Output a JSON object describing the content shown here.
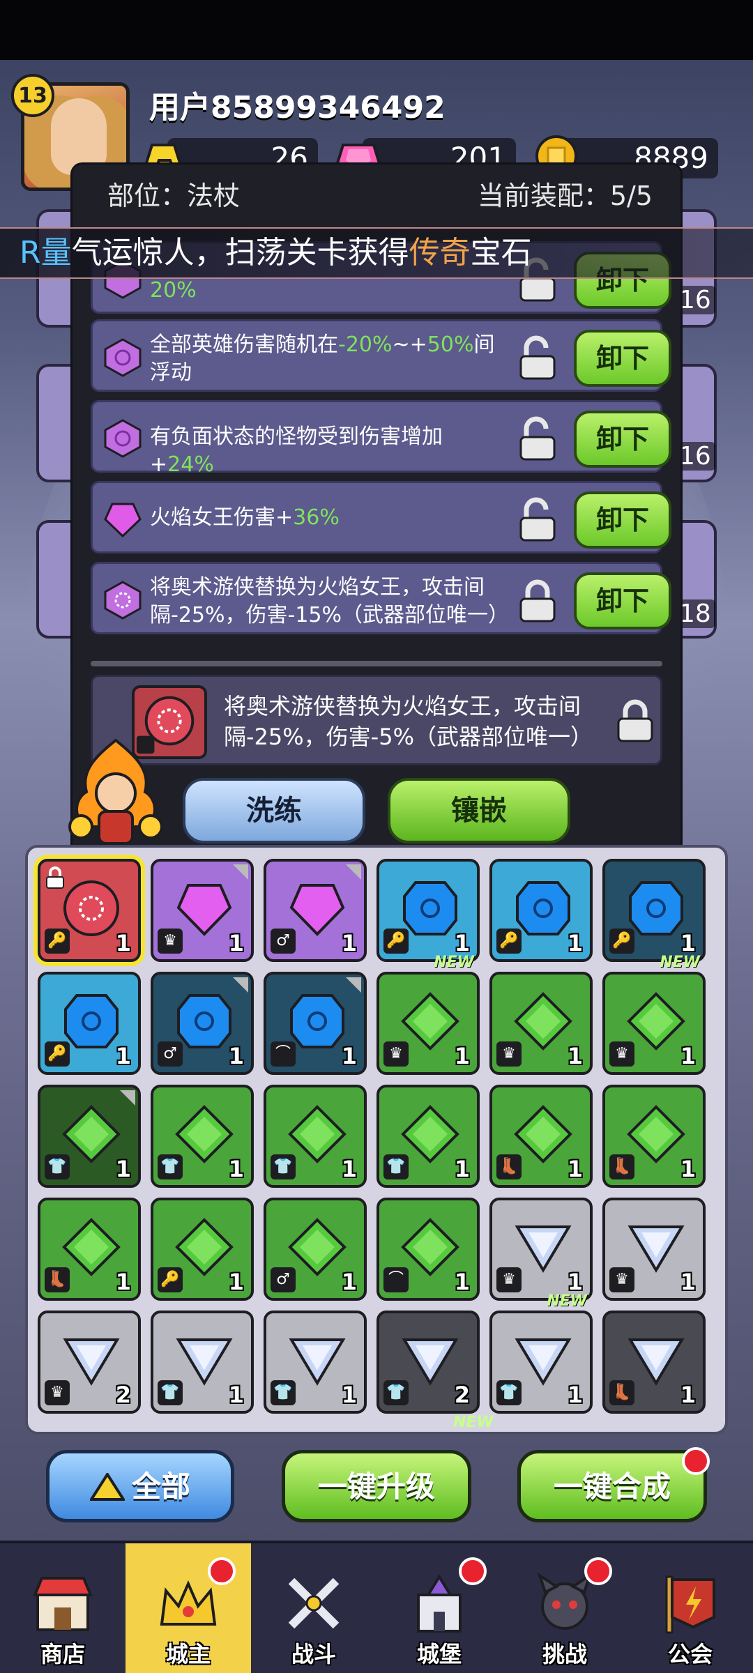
{
  "header": {
    "level": "13",
    "username": "用户85899346492",
    "resources": [
      {
        "name": "gold-bar",
        "value": "26",
        "color": "#f7d42a"
      },
      {
        "name": "pink-gem",
        "value": "201",
        "color": "#ff5fb8"
      },
      {
        "name": "gold-coin",
        "value": "8889",
        "color": "#f2b617"
      }
    ]
  },
  "marquee": {
    "prefix": "R量",
    "text1": "气运惊人，扫荡关卡获得",
    "highlight": "传奇",
    "text2": "宝石"
  },
  "popup": {
    "slot_label": "部位：法杖",
    "equipped_label": "当前装配：5/5",
    "gems": [
      {
        "pre": "",
        "mid": "20%",
        "post": "",
        "locked": false,
        "unload": "卸下",
        "color": "#c06ee0"
      },
      {
        "pre": "全部英雄伤害随机在",
        "v1": "-20%",
        "mid": "~+",
        "v2": "50%",
        "post": "间浮动",
        "locked": false,
        "unload": "卸下",
        "color": "#c06ee0"
      },
      {
        "pre": "有负面状态的怪物受到伤害增加+",
        "v1": "24%",
        "locked": false,
        "unload": "卸下",
        "color": "#c06ee0"
      },
      {
        "pre": "火焰女王伤害+",
        "v1": "36%",
        "locked": false,
        "unload": "卸下",
        "color": "#e05be8"
      },
      {
        "pre": "将奥术游侠替换为火焰女王，攻击间隔-25%，伤害-15%（武器部位唯一）",
        "locked": true,
        "unload": "卸下",
        "color": "#c06ee0"
      }
    ],
    "preview_text": "将奥术游侠替换为火焰女王，攻击间隔-25%，伤害-5%（武器部位唯一）",
    "refine_label": "洗练",
    "inlay_label": "镶嵌"
  },
  "side_counts": [
    "16",
    "16",
    "18"
  ],
  "inventory": [
    {
      "color": "red",
      "gem": "red",
      "slot": "🔑",
      "qty": "1",
      "sel": true,
      "lock": true
    },
    {
      "color": "purple",
      "gem": "purple",
      "slot": "♛",
      "qty": "1",
      "corner": true
    },
    {
      "color": "purple",
      "gem": "purple",
      "slot": "♂",
      "qty": "1",
      "corner": true
    },
    {
      "color": "blue",
      "gem": "blue",
      "slot": "🔑",
      "qty": "1"
    },
    {
      "color": "blue",
      "gem": "blue",
      "slot": "🔑",
      "qty": "1"
    },
    {
      "color": "dblue",
      "gem": "blue",
      "slot": "🔑",
      "qty": "1"
    },
    {
      "color": "blue",
      "gem": "blue",
      "slot": "🔑",
      "qty": "1"
    },
    {
      "color": "dblue",
      "gem": "blue",
      "slot": "♂",
      "qty": "1",
      "corner": true
    },
    {
      "color": "dblue",
      "gem": "blue",
      "slot": "⌒",
      "qty": "1",
      "corner": true
    },
    {
      "color": "green",
      "gem": "green",
      "slot": "♛",
      "qty": "1",
      "newtag": "NEW"
    },
    {
      "color": "green",
      "gem": "green",
      "slot": "♛",
      "qty": "1"
    },
    {
      "color": "green",
      "gem": "green",
      "slot": "♛",
      "qty": "1",
      "newtag": "NEW"
    },
    {
      "color": "dgreen",
      "gem": "green",
      "slot": "👕",
      "qty": "1",
      "corner": true
    },
    {
      "color": "green",
      "gem": "green",
      "slot": "👕",
      "qty": "1"
    },
    {
      "color": "green",
      "gem": "green",
      "slot": "👕",
      "qty": "1"
    },
    {
      "color": "green",
      "gem": "green",
      "slot": "👕",
      "qty": "1"
    },
    {
      "color": "green",
      "gem": "green",
      "slot": "👢",
      "qty": "1"
    },
    {
      "color": "green",
      "gem": "green",
      "slot": "👢",
      "qty": "1"
    },
    {
      "color": "green",
      "gem": "green",
      "slot": "👢",
      "qty": "1"
    },
    {
      "color": "green",
      "gem": "green",
      "slot": "🔑",
      "qty": "1"
    },
    {
      "color": "green",
      "gem": "green",
      "slot": "♂",
      "qty": "1"
    },
    {
      "color": "green",
      "gem": "green",
      "slot": "⌒",
      "qty": "1"
    },
    {
      "color": "grey",
      "gem": "white",
      "slot": "♛",
      "qty": "1"
    },
    {
      "color": "grey",
      "gem": "white",
      "slot": "♛",
      "qty": "1"
    },
    {
      "color": "grey",
      "gem": "white",
      "slot": "♛",
      "qty": "2"
    },
    {
      "color": "grey",
      "gem": "white",
      "slot": "👕",
      "qty": "1"
    },
    {
      "color": "grey",
      "gem": "white",
      "slot": "👕",
      "qty": "1"
    },
    {
      "color": "dgrey",
      "gem": "white",
      "slot": "👕",
      "qty": "2"
    },
    {
      "color": "grey",
      "gem": "white",
      "slot": "👕",
      "qty": "1",
      "newtag": "NEW"
    },
    {
      "color": "dgrey",
      "gem": "white",
      "slot": "👢",
      "qty": "1"
    }
  ],
  "extra_new": "NEW",
  "actions": {
    "all": "全部",
    "upgrade": "一键升级",
    "merge": "一键合成"
  },
  "tabs": [
    {
      "label": "商店",
      "icon": "shop-icon",
      "dot": false
    },
    {
      "label": "城主",
      "icon": "crown-icon",
      "dot": true,
      "active": true
    },
    {
      "label": "战斗",
      "icon": "swords-icon",
      "dot": false
    },
    {
      "label": "城堡",
      "icon": "castle-icon",
      "dot": true
    },
    {
      "label": "挑战",
      "icon": "demon-icon",
      "dot": true
    },
    {
      "label": "公会",
      "icon": "guild-flag-icon",
      "dot": false
    }
  ],
  "colors": {
    "accent_green": "#7ee35b",
    "tab_active": "#f3d24a",
    "notify": "#e8232f"
  }
}
